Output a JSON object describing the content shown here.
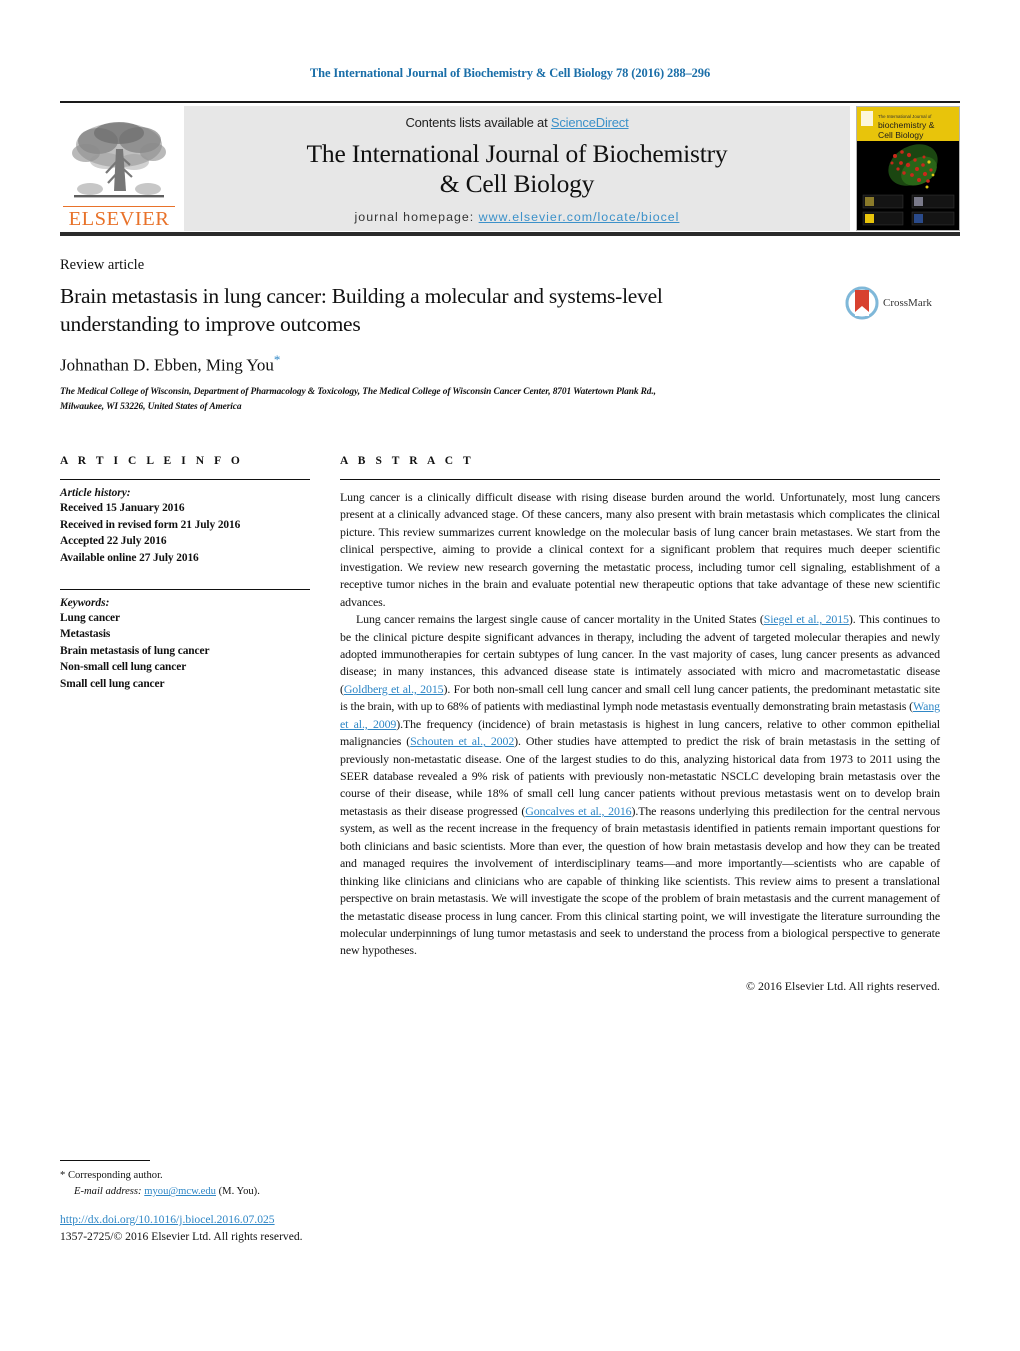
{
  "running_head": "The International Journal of Biochemistry & Cell Biology 78 (2016) 288–296",
  "masthead": {
    "contents_prefix": "Contents lists available at ",
    "sciencedirect": "ScienceDirect",
    "journal_title_line1": "The International Journal of Biochemistry",
    "journal_title_line2": "& Cell Biology",
    "homepage_prefix": "journal homepage: ",
    "homepage_url": "www.elsevier.com/locate/biocel",
    "publisher_name": "ELSEVIER",
    "cover_title_small": "The International Journal of",
    "cover_title_line1": "biochemistry &",
    "cover_title_line2": "Cell Biology"
  },
  "article": {
    "type": "Review article",
    "title": "Brain metastasis in lung cancer: Building a molecular and systems-level understanding to improve outcomes",
    "authors": "Johnathan D. Ebben, Ming You",
    "corresponding_marker": "*",
    "affiliation": "The Medical College of Wisconsin, Department of Pharmacology & Toxicology, The Medical College of Wisconsin Cancer Center, 8701 Watertown Plank Rd., Milwaukee, WI 53226, United States of America",
    "crossmark_label": "CrossMark"
  },
  "article_info": {
    "heading": "A R T I C L E   I N F O",
    "history_label": "Article history:",
    "history": [
      "Received 15 January 2016",
      "Received in revised form 21 July 2016",
      "Accepted 22 July 2016",
      "Available online 27 July 2016"
    ],
    "keywords_label": "Keywords:",
    "keywords": [
      "Lung cancer",
      "Metastasis",
      "Brain metastasis of lung cancer",
      "Non-small cell lung cancer",
      "Small cell lung cancer"
    ]
  },
  "abstract": {
    "heading": "A B S T R A C T",
    "paragraph1": "Lung cancer is a clinically difficult disease with rising disease burden around the world. Unfortunately, most lung cancers present at a clinically advanced stage. Of these cancers, many also present with brain metastasis which complicates the clinical picture. This review summarizes current knowledge on the molecular basis of lung cancer brain metastases. We start from the clinical perspective, aiming to provide a clinical context for a significant problem that requires much deeper scientific investigation. We review new research governing the metastatic process, including tumor cell signaling, establishment of a receptive tumor niches in the brain and evaluate potential new therapeutic options that take advantage of these new scientific advances.",
    "paragraph2_parts": [
      {
        "text": "Lung cancer remains the largest single cause of cancer mortality in the United States (",
        "cite": false
      },
      {
        "text": "Siegel et al., 2015",
        "cite": true
      },
      {
        "text": "). This continues to be the clinical picture despite significant advances in therapy, including the advent of targeted molecular therapies and newly adopted immunotherapies for certain subtypes of lung cancer. In the vast majority of cases, lung cancer presents as advanced disease; in many instances, this advanced disease state is intimately associated with micro and macrometastatic disease (",
        "cite": false
      },
      {
        "text": "Goldberg et al., 2015",
        "cite": true
      },
      {
        "text": "). For both non-small cell lung cancer and small cell lung cancer patients, the predominant metastatic site is the brain, with up to 68% of patients with mediastinal lymph node metastasis eventually demonstrating brain metastasis (",
        "cite": false
      },
      {
        "text": "Wang et al., 2009",
        "cite": true
      },
      {
        "text": ").The frequency (incidence) of brain metastasis is highest in lung cancers, relative to other common epithelial malignancies (",
        "cite": false
      },
      {
        "text": "Schouten et al., 2002",
        "cite": true
      },
      {
        "text": "). Other studies have attempted to predict the risk of brain metastasis in the setting of previously non-metastatic disease. One of the largest studies to do this, analyzing historical data from 1973 to 2011 using the SEER database revealed a 9% risk of patients with previously non-metastatic NSCLC developing brain metastasis over the course of their disease, while 18% of small cell lung cancer patients without previous metastasis went on to develop brain metastasis as their disease progressed (",
        "cite": false
      },
      {
        "text": "Goncalves et al., 2016",
        "cite": true
      },
      {
        "text": ").The reasons underlying this predilection for the central nervous system, as well as the recent increase in the frequency of brain metastasis identified in patients remain important questions for both clinicians and basic scientists. More than ever, the question of how brain metastasis develop and how they can be treated and managed requires the involvement of interdisciplinary teams—and more importantly—scientists who are capable of thinking like clinicians and clinicians who are capable of thinking like scientists. This review aims to present a translational perspective on brain metastasis. We will investigate the scope of the problem of brain metastasis and the current management of the metastatic disease process in lung cancer. From this clinical starting point, we will investigate the literature surrounding the molecular underpinnings of lung tumor metastasis and seek to understand the process from a biological perspective to generate new hypotheses.",
        "cite": false
      }
    ],
    "copyright": "© 2016 Elsevier Ltd. All rights reserved."
  },
  "footer": {
    "corresponding_author": "* Corresponding author.",
    "email_label": "E-mail address:",
    "email": "myou@mcw.edu",
    "email_suffix": "(M. You).",
    "doi": "http://dx.doi.org/10.1016/j.biocel.2016.07.025",
    "issn_line": "1357-2725/© 2016 Elsevier Ltd. All rights reserved."
  },
  "colors": {
    "link_blue": "#2F87C6",
    "sciencedirect_blue": "#3C91C9",
    "elsevier_orange": "#E8722A",
    "rule_black": "#1a1a1a",
    "band_gray": "#e7e7e7"
  }
}
